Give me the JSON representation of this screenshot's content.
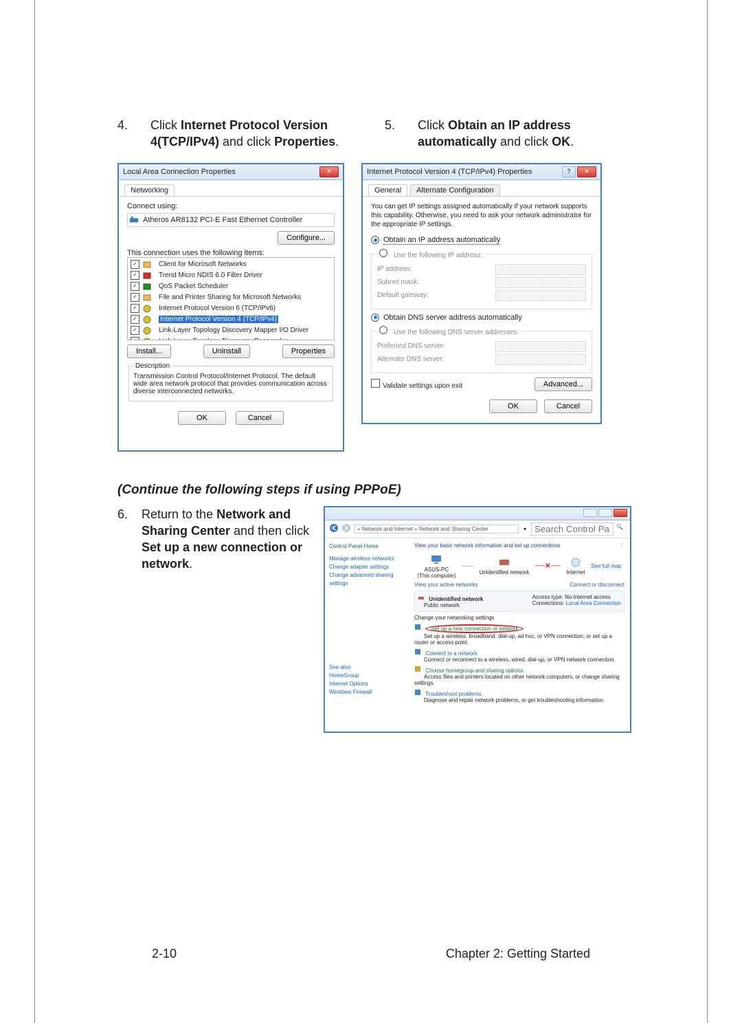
{
  "step4": {
    "num": "4.",
    "pre": "Click ",
    "bold1": "Internet Protocol Version 4(TCP/IPv4)",
    "mid": " and click ",
    "bold2": "Properties",
    "post": "."
  },
  "step5": {
    "num": "5.",
    "pre": "Click ",
    "bold1": "Obtain an IP address automatically",
    "mid": " and click ",
    "bold2": "OK",
    "post": "."
  },
  "section_sub": "(Continue the following steps if using PPPoE)",
  "step6": {
    "num": "6.",
    "pre": "Return to the ",
    "bold1": "Network and Sharing Center",
    "mid": " and then click ",
    "bold2": "Set up a new connection or network",
    "post": "."
  },
  "dlg1": {
    "title": "Local Area Connection Properties",
    "tab1": "Networking",
    "connect_using": "Connect using:",
    "adapter": "Atheros AR8132 PCI-E Fast Ethernet Controller",
    "configure": "Configure...",
    "uses": "This connection uses the following items:",
    "items": [
      "Client for Microsoft Networks",
      "Trend Micro NDIS 6.0 Filter Driver",
      "QoS Packet Scheduler",
      "File and Printer Sharing for Microsoft Networks",
      "Internet Protocol Version 6 (TCP/IPv6)",
      "Internet Protocol Version 4 (TCP/IPv4)",
      "Link-Layer Topology Discovery Mapper I/O Driver",
      "Link-Layer Topology Discovery Responder"
    ],
    "install": "Install...",
    "uninstall": "Uninstall",
    "properties": "Properties",
    "desc_legend": "Description",
    "desc": "Transmission Control Protocol/Internet Protocol. The default wide area network protocol that provides communication across diverse interconnected networks.",
    "ok": "OK",
    "cancel": "Cancel"
  },
  "dlg2": {
    "title": "Internet Protocol Version 4 (TCP/IPv4) Properties",
    "tab1": "General",
    "tab2": "Alternate Configuration",
    "intro": "You can get IP settings assigned automatically if your network supports this capability. Otherwise, you need to ask your network administrator for the appropriate IP settings.",
    "opt_auto_ip": "Obtain an IP address automatically",
    "opt_use_ip": "Use the following IP address:",
    "ip_address": "IP address:",
    "subnet": "Subnet mask:",
    "gateway": "Default gateway:",
    "opt_auto_dns": "Obtain DNS server address automatically",
    "opt_use_dns": "Use the following DNS server addresses:",
    "pref_dns": "Preferred DNS server:",
    "alt_dns": "Alternate DNS server:",
    "validate": "Validate settings upon exit",
    "advanced": "Advanced...",
    "ok": "OK",
    "cancel": "Cancel"
  },
  "nsc": {
    "crumbs": "« Network and Internet » Network and Sharing Center",
    "search_ph": "Search Control Panel",
    "cp_home": "Control Panel Home",
    "side": [
      "Manage wireless networks",
      "Change adapter settings",
      "Change advanced sharing settings"
    ],
    "see_also": "See also",
    "see_links": [
      "HomeGroup",
      "Internet Options",
      "Windows Firewall"
    ],
    "h1": "View your basic network information and set up connections",
    "see_full": "See full map",
    "this_pc": "ASUS-PC",
    "this_pc_sub": "(This computer)",
    "unid": "Unidentified network",
    "internet": "Internet",
    "view_active": "View your active networks",
    "conn_disc": "Connect or disconnect",
    "unid2": "Unidentified network",
    "pubnet": "Public network",
    "access_label": "Access type:",
    "access_val": "No Internet access",
    "conns_label": "Connections:",
    "conns_val": "Local Area Connection",
    "change_settings": "Change your networking settings",
    "item1": "Set up a new connection or network",
    "item1_desc": "Set up a wireless, broadband, dial-up, ad hoc, or VPN connection; or set up a router or access point.",
    "item2": "Connect to a network",
    "item2_desc": "Connect or reconnect to a wireless, wired, dial-up, or VPN network connection.",
    "item3": "Choose homegroup and sharing options",
    "item3_desc": "Access files and printers located on other network computers, or change sharing settings.",
    "item4": "Troubleshoot problems",
    "item4_desc": "Diagnose and repair network problems, or get troubleshooting information."
  },
  "footer": {
    "page": "2-10",
    "chapter": "Chapter 2: Getting Started"
  }
}
